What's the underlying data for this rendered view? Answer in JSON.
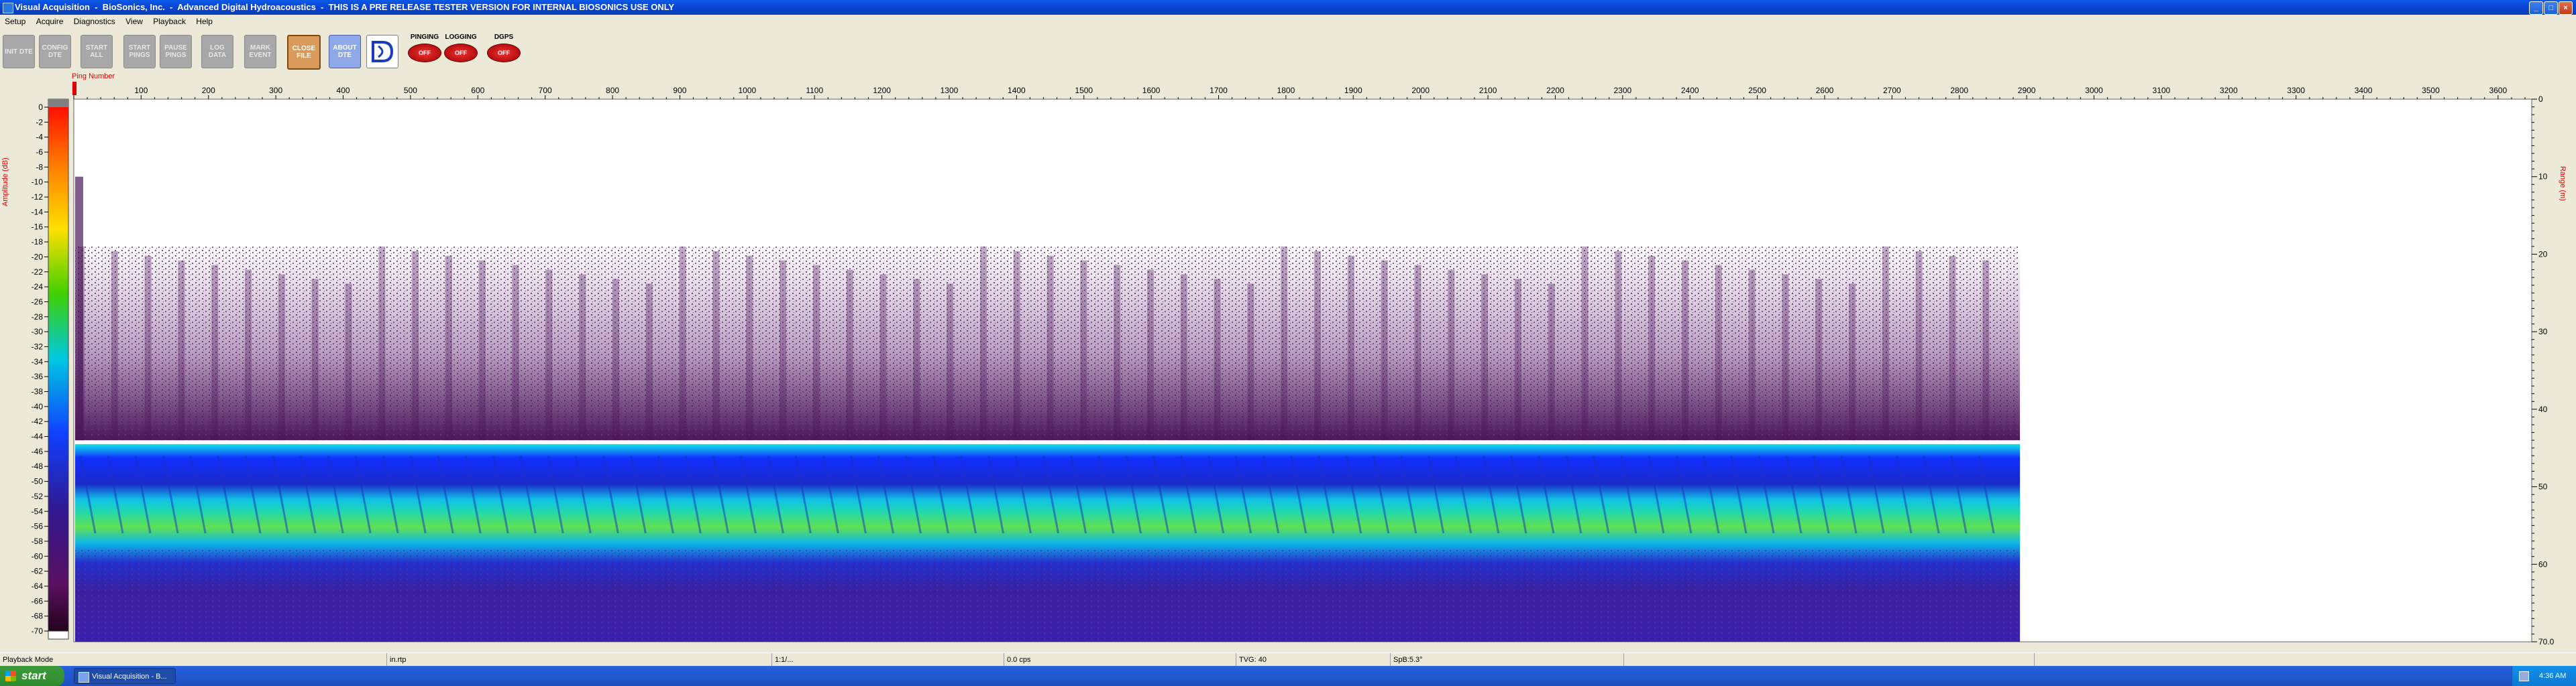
{
  "window": {
    "title": "Visual Acquisition  -  BioSonics, Inc.  -  Advanced Digital Hydroacoustics  -  THIS IS A PRE RELEASE TESTER VERSION FOR INTERNAL BIOSONICS USE ONLY",
    "min_label": "_",
    "max_label": "□",
    "close_label": "×"
  },
  "menu": [
    "Setup",
    "Acquire",
    "Diagnostics",
    "View",
    "Playback",
    "Help"
  ],
  "toolbar": {
    "buttons": [
      {
        "name": "init-dte-button",
        "label": "INIT DTE"
      },
      {
        "name": "config-dte-button",
        "label": "CONFIG DTE"
      },
      {
        "name": "start-all-button",
        "label": "START ALL"
      },
      {
        "name": "start-pings-button",
        "label": "START PINGS"
      },
      {
        "name": "pause-pings-button",
        "label": "PAUSE PINGS"
      },
      {
        "name": "log-data-button",
        "label": "LOG DATA"
      },
      {
        "name": "mark-event-button",
        "label": "MARK EVENT"
      },
      {
        "name": "close-file-button",
        "label": "CLOSE FILE"
      },
      {
        "name": "about-dte-button",
        "label": "ABOUT DTE"
      }
    ],
    "indicators": [
      {
        "name": "pinging-indicator",
        "label": "PINGING",
        "state": "OFF"
      },
      {
        "name": "logging-indicator",
        "label": "LOGGING",
        "state": "OFF"
      },
      {
        "name": "dgps-indicator",
        "label": "DGPS",
        "state": "OFF"
      }
    ]
  },
  "plot": {
    "x_axis_title": "Ping Number",
    "x_ticks": [
      100,
      200,
      300,
      400,
      500,
      600,
      700,
      800,
      900,
      1000,
      1100,
      1200,
      1300,
      1400,
      1500,
      1600,
      1700,
      1800,
      1900,
      2000,
      2100,
      2200,
      2300,
      2400,
      2500,
      2600,
      2700,
      2800,
      2900,
      3000,
      3100,
      3200,
      3300,
      3400,
      3500,
      3600
    ],
    "y_axis_left_title": "Amplitude (dB)",
    "y_axis_left_ticks": [
      0,
      -2,
      -4,
      -6,
      -8,
      -10,
      -12,
      -14,
      -16,
      -18,
      -20,
      -22,
      -24,
      -26,
      -28,
      -30,
      -32,
      -34,
      -36,
      -38,
      -40,
      -42,
      -44,
      -46,
      -48,
      -50,
      -52,
      -54,
      -56,
      -58,
      -60,
      -62,
      -64,
      -66,
      -68,
      -70
    ],
    "y_axis_right_title": "Range (m)",
    "y_axis_right_ticks": [
      "0",
      "10",
      "20",
      "30",
      "40",
      "50",
      "60",
      "70.0"
    ],
    "colors": {
      "bottom_band": "#1ec8e0",
      "deep": "#3020c0",
      "water_column": "#5a1a6a",
      "axis_title": "#e00000"
    }
  },
  "chart_data": {
    "type": "heatmap",
    "title": "",
    "xlabel": "Ping Number",
    "ylabel": "Range (m)",
    "xlim": [
      0,
      3650
    ],
    "ylim_range_m": [
      0,
      70.0
    ],
    "colorbar_label": "Amplitude (dB)",
    "colorbar_range_db": [
      -70,
      0
    ],
    "data_extent_pings": [
      0,
      2890
    ],
    "layers": [
      {
        "range_m": [
          19,
          44
        ],
        "level_db": -64
      },
      {
        "range_m": [
          44.5,
          46
        ],
        "level_db": -40
      },
      {
        "range_m": [
          46,
          58
        ],
        "level_db": -46
      },
      {
        "range_m": [
          58,
          70
        ],
        "level_db": -62
      }
    ]
  },
  "statusbar": {
    "fields": [
      "Playback Mode",
      "in.rtp",
      "1:1/...",
      "0.0 cps",
      "TVG: 40",
      "SpB:5.3°"
    ]
  },
  "taskbar": {
    "start_label": "start",
    "task_label": "Visual Acquisition - B...",
    "clock": "4:36 AM"
  }
}
